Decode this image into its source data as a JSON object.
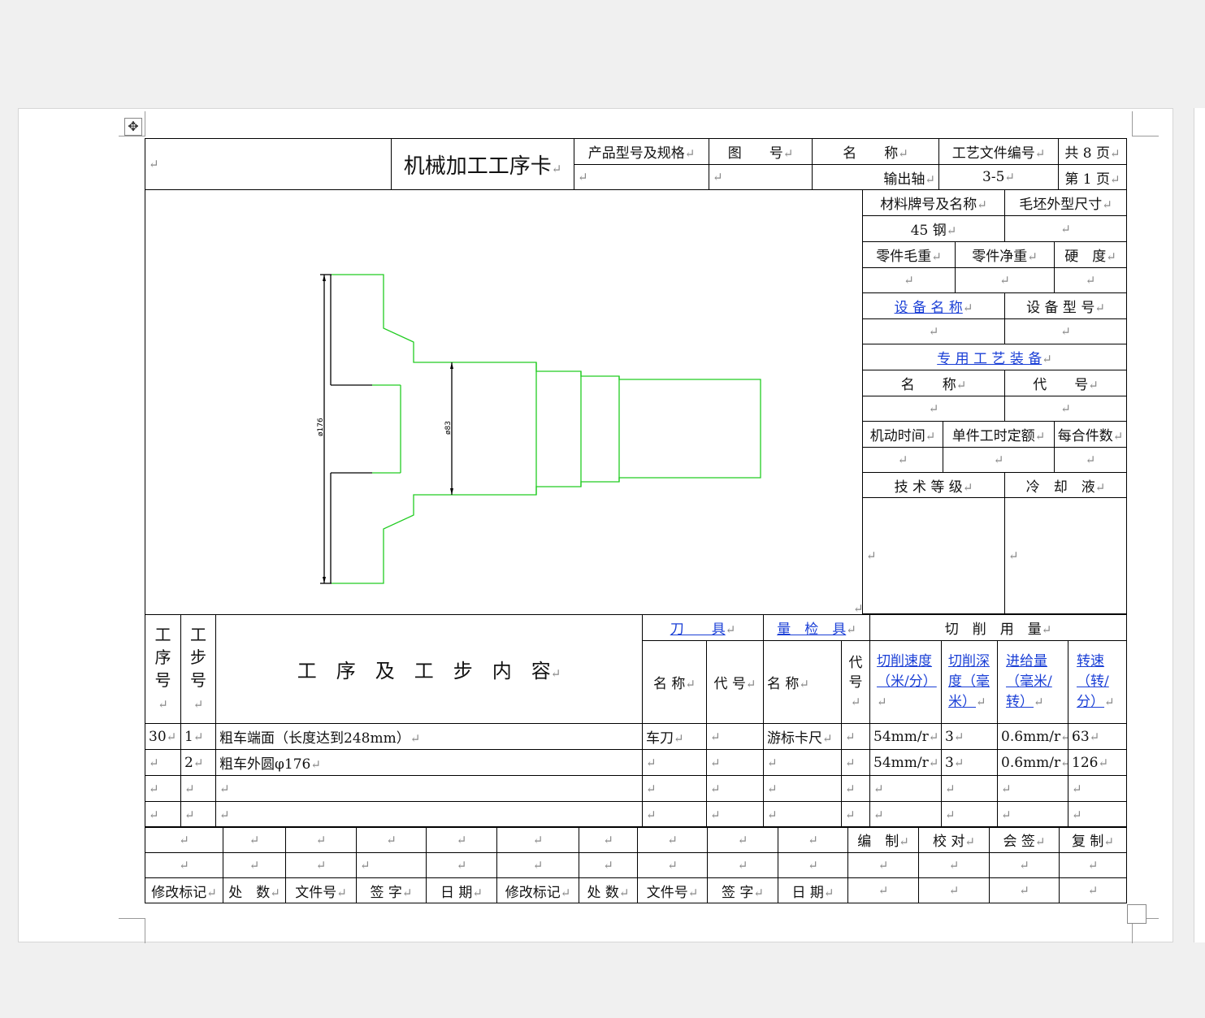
{
  "header": {
    "title": "机械加工工序卡",
    "product_model_label": "产品型号及规格",
    "drawing_no_label": "图　　号",
    "name_label": "名　　称",
    "process_doc_label": "工艺文件编号",
    "total_pages": "共 8 页",
    "part_name": "输出轴",
    "process_doc_no": "3-5",
    "page_no": "第 1 页"
  },
  "right_panel": {
    "material_label": "材料牌号及名称",
    "blank_label": "毛坯外型尺寸",
    "material": "45 钢",
    "gross_weight_label": "零件毛重",
    "net_weight_label": "零件净重",
    "hardness_label": "硬　度",
    "equipment_name_label": "设 备 名 称",
    "equipment_model_label": "设 备 型 号",
    "special_equipment_label": "专 用 工 艺  装 备",
    "name_label": "名　　称",
    "code_label": "代　　号",
    "machine_time_label": "机动时间",
    "unit_time_label": "单件工时定额",
    "per_pieces_label": "每合件数",
    "tech_grade_label": "技 术 等 级",
    "coolant_label": "冷　却　液"
  },
  "drawing": {
    "dim_large": "ø176",
    "dim_small": "ø83",
    "line_color": "#22cc22"
  },
  "ops_table": {
    "col_op_no": "工序号",
    "col_step_no": "工步号",
    "col_content": "工　序　及　工　步　内　容",
    "tool_label": "刀　　具",
    "gauge_label": "量　检　具",
    "cutting_label": "切　削　用　量",
    "tool_name": "名 称",
    "tool_code": "代 号",
    "gauge_name": "名 称",
    "gauge_code": "代号",
    "speed_label": "切削速度（米/分）",
    "depth_label": "切削深度（毫米）",
    "feed_label": "进给量（毫米/转）",
    "rpm_label": "转速（转/分）",
    "rows": [
      {
        "op": "30",
        "step": "1",
        "content": "粗车端面（长度达到248mm）",
        "tool": "车刀",
        "tool_code": "",
        "gauge": "游标卡尺",
        "gauge_code": "",
        "speed": "54mm/r",
        "depth": "3",
        "feed": "0.6mm/r",
        "rpm": "63"
      },
      {
        "op": "",
        "step": "2",
        "content": "粗车外圆φ176",
        "tool": "",
        "tool_code": "",
        "gauge": "",
        "gauge_code": "",
        "speed": "54mm/r",
        "depth": "3",
        "feed": "0.6mm/r",
        "rpm": "126"
      },
      {
        "op": "",
        "step": "",
        "content": "",
        "tool": "",
        "tool_code": "",
        "gauge": "",
        "gauge_code": "",
        "speed": "",
        "depth": "",
        "feed": "",
        "rpm": ""
      },
      {
        "op": "",
        "step": "",
        "content": "",
        "tool": "",
        "tool_code": "",
        "gauge": "",
        "gauge_code": "",
        "speed": "",
        "depth": "",
        "feed": "",
        "rpm": ""
      }
    ]
  },
  "footer": {
    "compile": "编　制",
    "check": "校 对",
    "countersign": "会 签",
    "review": "复 制",
    "rev_mark": "修改标记",
    "place": "处　数",
    "doc_no": "文件号",
    "sign": "签 字",
    "date": "日 期",
    "rev_mark2": "修改标记",
    "place2": "处 数",
    "doc_no2": "文件号",
    "sign2": "签 字",
    "date2": "日 期"
  },
  "pilcrow": "↵"
}
